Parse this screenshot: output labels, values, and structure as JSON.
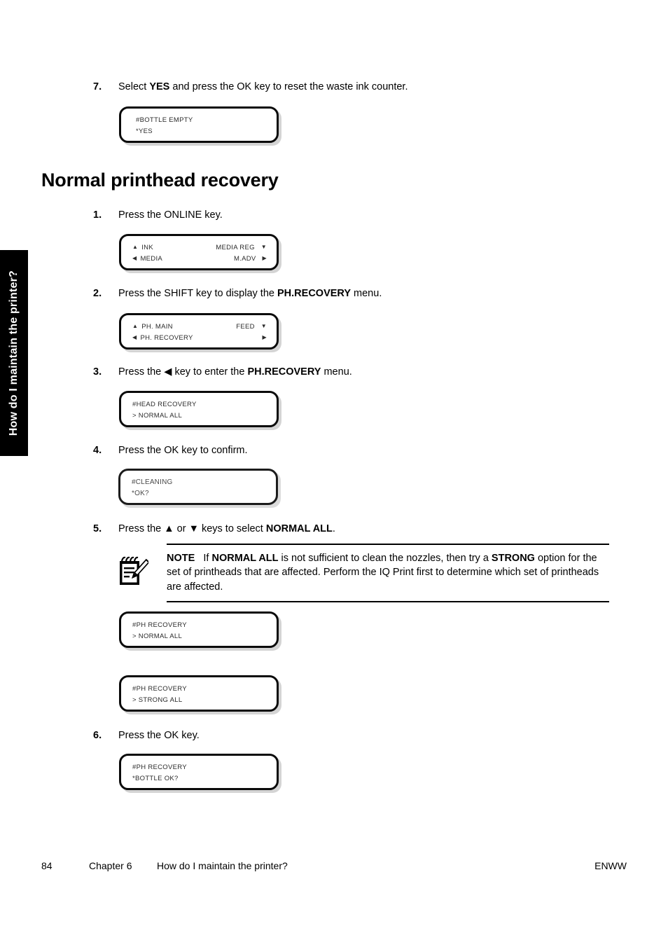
{
  "side_tab": {
    "label": "How do I maintain the printer?"
  },
  "section": {
    "title": "Normal printhead recovery"
  },
  "steps": {
    "s7": {
      "num": "7.",
      "text_pre": "Select ",
      "bold": "YES",
      "text_post": " and press the OK key to reset the waste ink counter."
    },
    "s1": {
      "num": "1.",
      "text_pre": "Press the ONLINE key.",
      "bold": "",
      "text_post": ""
    },
    "s2": {
      "num": "2.",
      "text_pre": "Press the SHIFT key to display the ",
      "bold": "PH.RECOVERY",
      "text_post": " menu."
    },
    "s3": {
      "num": "3.",
      "text_pre": "Press the ◀ key to enter the ",
      "bold": "PH.RECOVERY",
      "text_post": " menu."
    },
    "s4": {
      "num": "4.",
      "text_pre": "Press the OK key to confirm.",
      "bold": "",
      "text_post": ""
    },
    "s5": {
      "num": "5.",
      "text_pre": "Press the ▲ or ▼ keys to select ",
      "bold": "NORMAL ALL",
      "text_post": "."
    },
    "s6": {
      "num": "6.",
      "text_pre": "Press the OK key.",
      "bold": "",
      "text_post": ""
    }
  },
  "panels": {
    "bottle_empty": {
      "line1_left": "#BOTTLE EMPTY",
      "line1_right": "",
      "line1_arrow_pre": "",
      "line1_arrow_post": "",
      "line2_left": "*YES",
      "line2_right": "",
      "line2_arrow_pre": "",
      "line2_arrow_post": ""
    },
    "online": {
      "line1_left": "INK",
      "line1_right": "MEDIA REG",
      "line1_arrow_pre": "▲",
      "line1_arrow_post": "▼",
      "line2_left": "MEDIA",
      "line2_right": "M.ADV",
      "line2_arrow_pre": "◀",
      "line2_arrow_post": "▶"
    },
    "ph_main": {
      "line1_left": "PH. MAIN",
      "line1_right": "FEED",
      "line1_arrow_pre": "▲",
      "line1_arrow_post": "▼",
      "line2_left": "PH. RECOVERY",
      "line2_right": "",
      "line2_arrow_pre": "◀",
      "line2_arrow_post": "▶"
    },
    "head_recovery": {
      "line1_left": "#HEAD RECOVERY",
      "line1_right": "",
      "line1_arrow_pre": "",
      "line1_arrow_post": "",
      "line2_left": "> NORMAL ALL",
      "line2_right": "",
      "line2_arrow_pre": "",
      "line2_arrow_post": ""
    },
    "cleaning": {
      "line1_left": "#CLEANING",
      "line1_right": "",
      "line1_arrow_pre": "",
      "line1_arrow_post": "",
      "line2_left": "*OK?",
      "line2_right": "",
      "line2_arrow_pre": "",
      "line2_arrow_post": ""
    },
    "ph_recovery_normal": {
      "line1_left": "#PH RECOVERY",
      "line1_right": "",
      "line1_arrow_pre": "",
      "line1_arrow_post": "",
      "line2_left": "> NORMAL ALL",
      "line2_right": "",
      "line2_arrow_pre": "",
      "line2_arrow_post": ""
    },
    "ph_recovery_strong": {
      "line1_left": "#PH RECOVERY",
      "line1_right": "",
      "line1_arrow_pre": "",
      "line1_arrow_post": "",
      "line2_left": "> STRONG ALL",
      "line2_right": "",
      "line2_arrow_pre": "",
      "line2_arrow_post": ""
    },
    "ph_recovery_bottle": {
      "line1_left": "#PH RECOVERY",
      "line1_right": "",
      "line1_arrow_pre": "",
      "line1_arrow_post": "",
      "line2_left": "*BOTTLE OK?",
      "line2_right": "",
      "line2_arrow_pre": "",
      "line2_arrow_post": ""
    }
  },
  "note": {
    "label": "NOTE",
    "part1": "If ",
    "bold1": "NORMAL ALL",
    "part2": " is not sufficient to clean the nozzles, then try a ",
    "bold2": "STRONG",
    "part3": " option for the set of printheads that are affected. Perform the IQ Print first to determine which set of printheads are affected."
  },
  "footer": {
    "page": "84",
    "chapter": "Chapter 6",
    "title": "How do I maintain the printer?",
    "enww": "ENWW"
  }
}
